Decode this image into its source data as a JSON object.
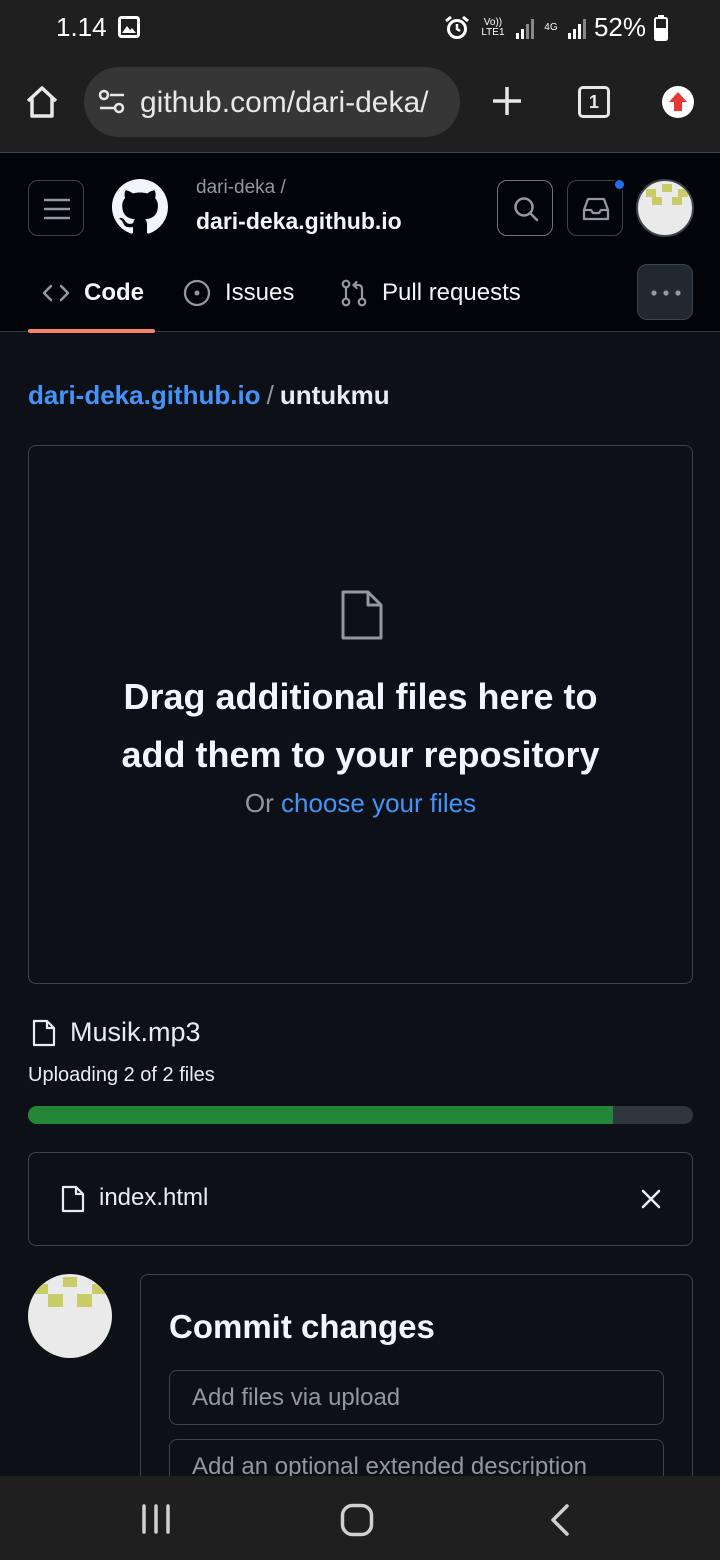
{
  "status_bar": {
    "time": "1.14",
    "network_label_1": "Vo)) LTE1",
    "network_label_2": "4G",
    "battery": "52%"
  },
  "browser": {
    "url": "github.com/dari-deka/",
    "tab_count": "1"
  },
  "header": {
    "owner": "dari-deka /",
    "repo": "dari-deka.github.io",
    "tabs": [
      {
        "label": "Code",
        "icon": "code-icon",
        "active": true
      },
      {
        "label": "Issues",
        "icon": "issue-icon",
        "active": false
      },
      {
        "label": "Pull requests",
        "icon": "pull-request-icon",
        "active": false
      }
    ]
  },
  "breadcrumb": {
    "repo": "dari-deka.github.io",
    "separator": "/",
    "folder": "untukmu"
  },
  "dropzone": {
    "title": "Drag additional files here to add them to your repository",
    "or_text": "Or",
    "choose_link": "choose your files"
  },
  "upload": {
    "current_file": "Musik.mp3",
    "status": "Uploading 2 of 2 files",
    "progress_fraction": 0.88
  },
  "queued_file": {
    "name": "index.html"
  },
  "commit": {
    "title": "Commit changes",
    "summary_placeholder": "Add files via upload",
    "description_placeholder": "Add an optional extended description"
  },
  "colors": {
    "background": "#0d1117",
    "header": "#010409",
    "link": "#4493f8",
    "progress": "#238636",
    "tab_underline": "#f78166"
  }
}
